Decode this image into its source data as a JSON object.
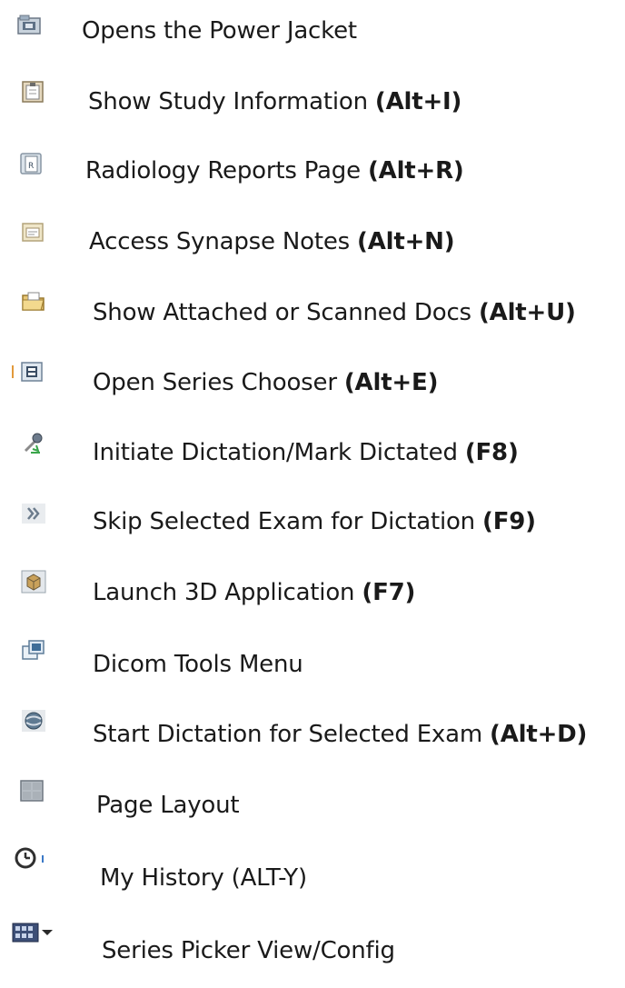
{
  "items": [
    {
      "icon": "power-jacket-icon",
      "label": "Opens the Power Jacket",
      "shortcut": ""
    },
    {
      "icon": "study-info-icon",
      "label": "Show Study Information ",
      "shortcut": "(Alt+I)"
    },
    {
      "icon": "radiology-report-icon",
      "label": "Radiology Reports Page ",
      "shortcut": "(Alt+R)"
    },
    {
      "icon": "notes-icon",
      "label": "Access Synapse Notes ",
      "shortcut": "(Alt+N)"
    },
    {
      "icon": "folder-icon",
      "label": "Show Attached or Scanned Docs ",
      "shortcut": "(Alt+U)"
    },
    {
      "icon": "series-chooser-icon",
      "label": "Open Series Chooser ",
      "shortcut": "(Alt+E)"
    },
    {
      "icon": "microphone-icon",
      "label": "Initiate Dictation/Mark Dictated ",
      "shortcut": "(F8)"
    },
    {
      "icon": "double-chevron-icon",
      "label": "Skip Selected Exam for Dictation ",
      "shortcut": "(F9)"
    },
    {
      "icon": "cube-3d-icon",
      "label": "Launch 3D Application ",
      "shortcut": "(F7)"
    },
    {
      "icon": "dicom-tools-icon",
      "label": "Dicom Tools Menu",
      "shortcut": ""
    },
    {
      "icon": "dictation-globe-icon",
      "label": "Start Dictation for Selected Exam ",
      "shortcut": "(Alt+D)"
    },
    {
      "icon": "page-layout-icon",
      "label": "Page Layout",
      "shortcut": ""
    },
    {
      "icon": "clock-icon",
      "label": "My History (ALT-Y)",
      "shortcut": ""
    },
    {
      "icon": "series-picker-icon",
      "label": "Series Picker View/Config",
      "shortcut": ""
    }
  ]
}
